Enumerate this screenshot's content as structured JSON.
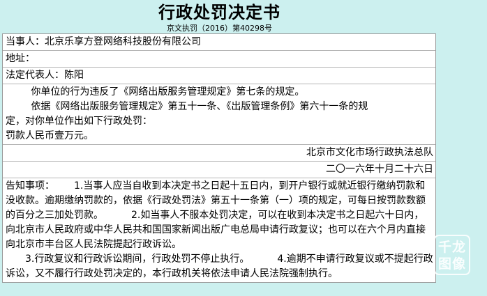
{
  "title": "行政处罚决定书",
  "doc_number": "京文执罚（2016）第40298号",
  "party_label": "当事人：",
  "party_name": "北京乐享方登网络科技股份有限公司",
  "address_label": "地址：",
  "address_value": "",
  "legal_rep_label": "法定代表人：",
  "legal_rep_name": "陈阳",
  "violation_text": "你单位的行为违反了《网络出版服务管理规定》第七条的规定。",
  "basis_text_1": "依据《网络出版服务管理规定》第五十一条、《出版管理条例》第六十一条的规",
  "basis_text_2": "定，对你单位作出如下行政处罚：",
  "penalty_text": "罚款人民币壹万元。",
  "agency": "北京市文化市场行政执法总队",
  "date": "二〇一六年十月二十六日",
  "notice_label": "告知事项：",
  "notice_item_1": "1.当事人应当自收到本决定书之日起十五日内，到开户银行或就近银行缴纳罚款和没收款。逾期缴纳罚款的，依据《行政处罚法》第五十一条第（一）项的规定，可每日按罚款数额的百分之三加处罚款。",
  "notice_item_2": "2.如当事人不服本处罚决定，可以在收到本决定书之日起六十日内，向北京市人民政府或中华人民共和国国家新闻出版广电总局申请行政复议；也可以在六个月内直接向北京市丰台区人民法院提起行政诉讼。",
  "notice_item_3": "3.行政复议和行政诉讼期间，行政处罚不停止执行。",
  "notice_item_4": "4.逾期不申请行政复议或不提起行政诉讼，又不履行行政处罚决定的，本行政机关将依法申请人民法院强制执行。",
  "watermark_line1": "千龙",
  "watermark_line2": "图像"
}
